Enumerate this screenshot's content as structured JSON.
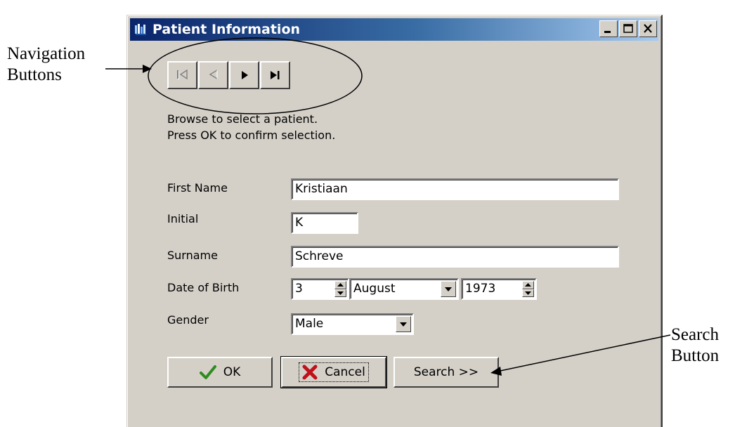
{
  "annotations": {
    "navigation": "Navigation Buttons",
    "navigation_line1": "Navigation",
    "navigation_line2": "Buttons",
    "search_line1": "Search",
    "search_line2": "Button"
  },
  "window": {
    "title": "Patient Information",
    "controls": [
      "minimize",
      "maximize",
      "close"
    ]
  },
  "nav_buttons": [
    {
      "name": "first-record",
      "icon": "first-icon",
      "enabled": false
    },
    {
      "name": "previous-record",
      "icon": "previous-icon",
      "enabled": false
    },
    {
      "name": "next-record",
      "icon": "next-icon",
      "enabled": true
    },
    {
      "name": "last-record",
      "icon": "last-icon",
      "enabled": true
    }
  ],
  "instructions": {
    "line1": "Browse to select a patient.",
    "line2": "Press OK to confirm selection."
  },
  "form": {
    "first_name_label": "First Name",
    "first_name_value": "Kristiaan",
    "initial_label": "Initial",
    "initial_value": "K",
    "surname_label": "Surname",
    "surname_value": "Schreve",
    "dob_label": "Date of Birth",
    "dob_day": "3",
    "dob_month": "August",
    "dob_year": "1973",
    "gender_label": "Gender",
    "gender_value": "Male"
  },
  "buttons": {
    "ok": "OK",
    "cancel": "Cancel",
    "search": "Search >>"
  },
  "colors": {
    "window_bg": "#d4d0c8",
    "titlebar_start": "#0a246a",
    "titlebar_end": "#a6caf0",
    "ok_check": "#2e8b1e",
    "cancel_x": "#c0101a"
  }
}
